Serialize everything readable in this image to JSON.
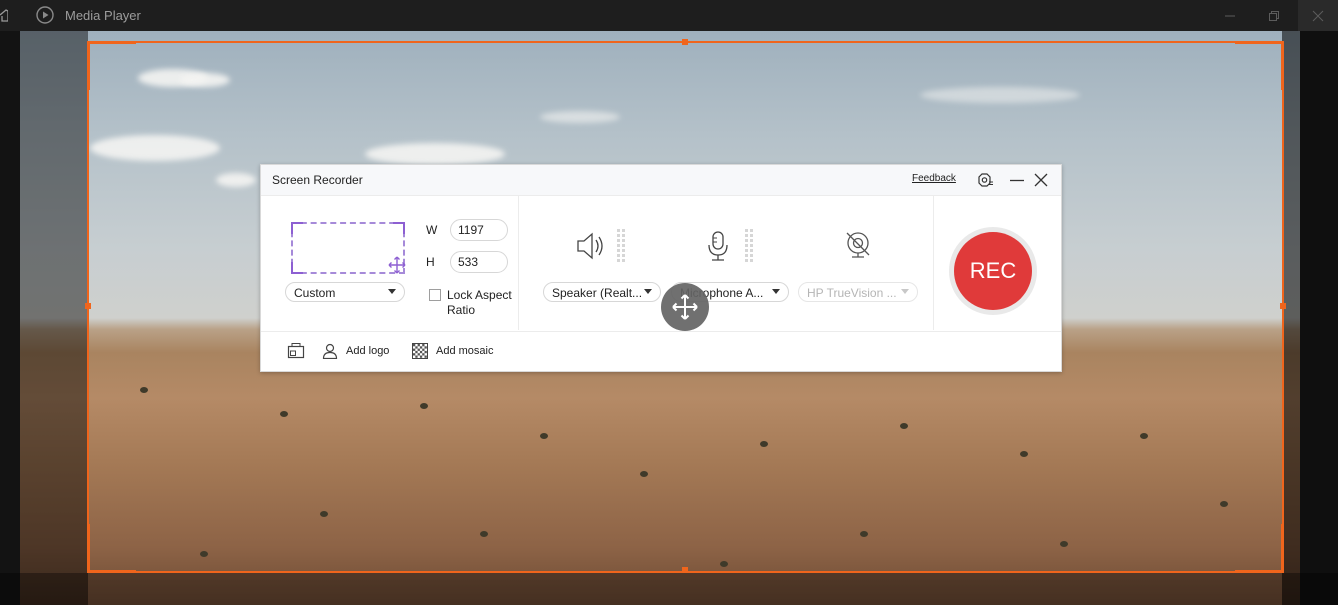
{
  "window": {
    "title": "Media Player",
    "icons": {
      "home": "home-icon",
      "app": "play-icon",
      "minimize": "minimize-icon",
      "maximize": "maximize-icon",
      "close": "close-icon"
    }
  },
  "selection": {
    "accent_color": "#f0651c"
  },
  "recorder": {
    "title": "Screen Recorder",
    "feedback_label": "Feedback",
    "region": {
      "preset": "Custom",
      "width_label": "W",
      "height_label": "H",
      "width": "1197",
      "height": "533",
      "lock_aspect_label": "Lock Aspect Ratio",
      "lock_aspect_checked": false
    },
    "audio": {
      "speaker": "Speaker (Realt...",
      "microphone": "Microphone A...",
      "camera": "HP TrueVision ..."
    },
    "rec_label": "REC",
    "rec_color": "#e03a3a",
    "tools": {
      "add_logo": "Add logo",
      "add_mosaic": "Add mosaic"
    }
  }
}
